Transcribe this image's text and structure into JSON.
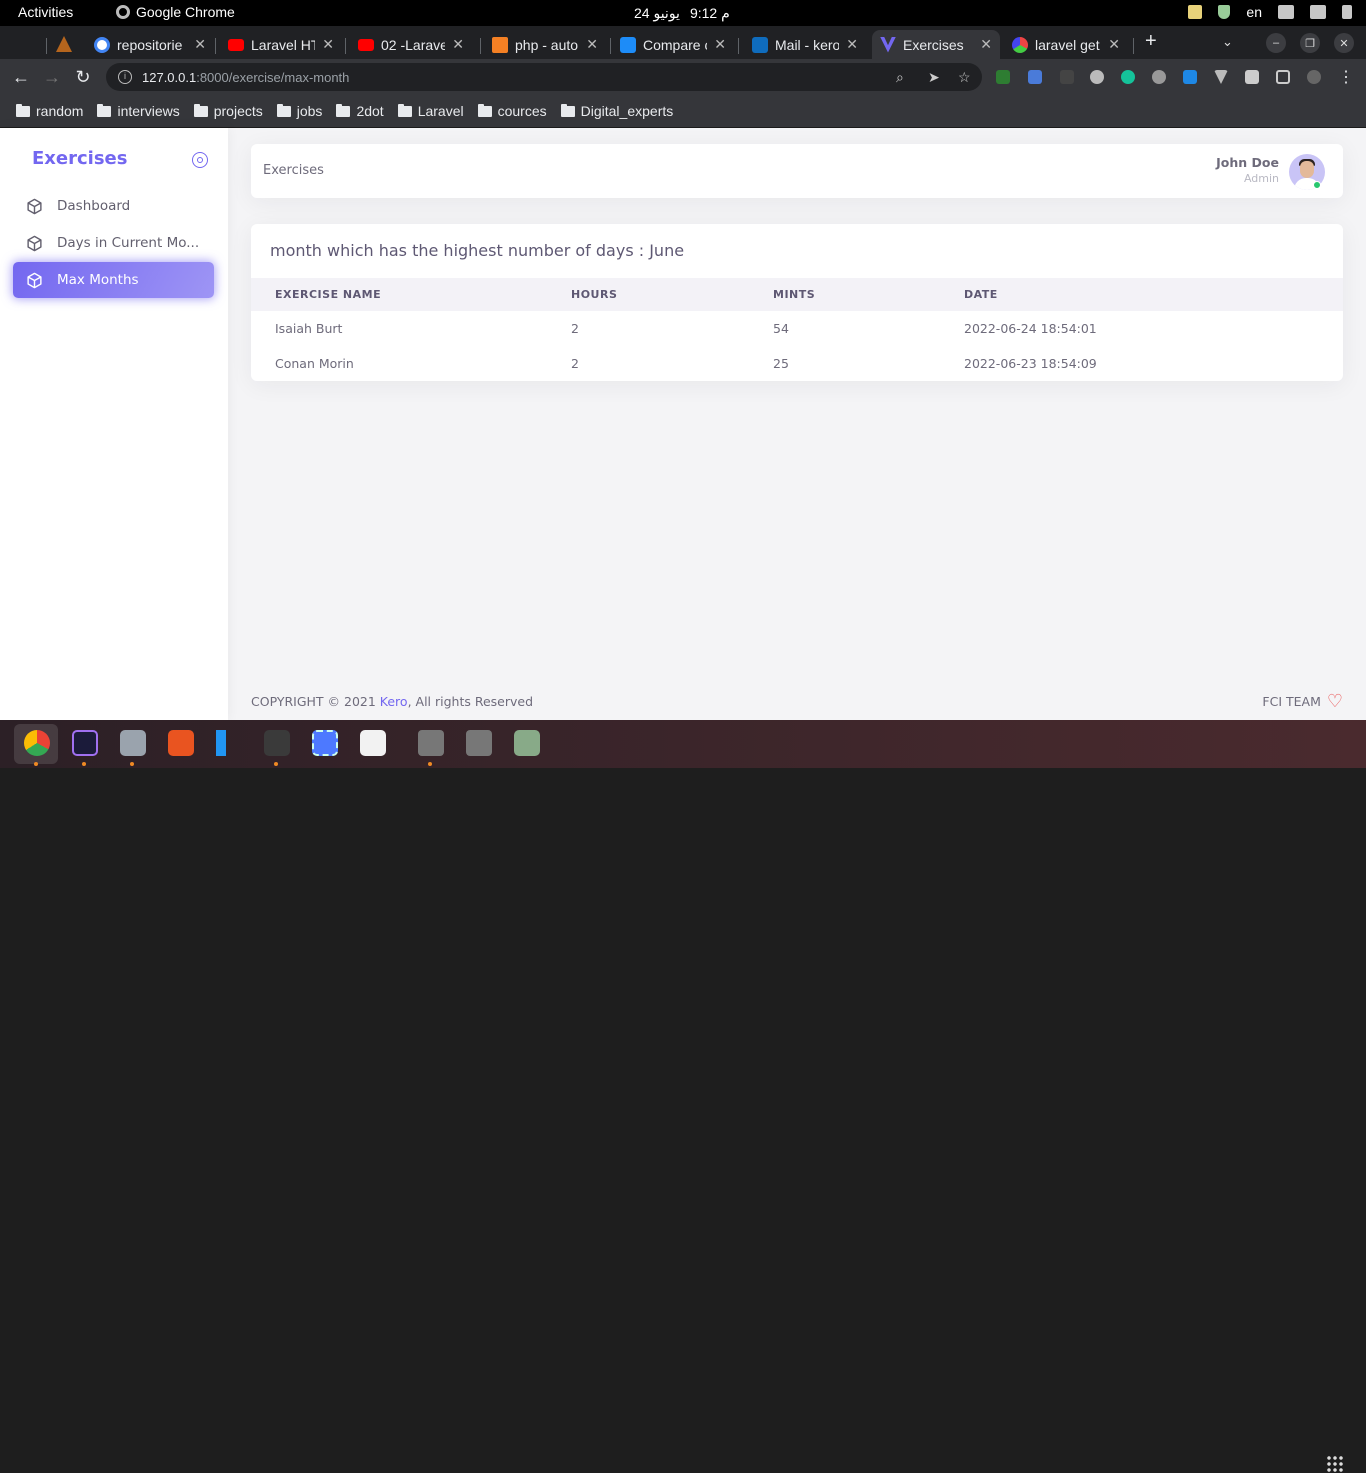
{
  "os": {
    "activities": "Activities",
    "app_name": "Google Chrome",
    "time": "9:12 م",
    "date": "24 يونيو",
    "language": "en"
  },
  "tabs": [
    {
      "title": "repositorie",
      "icon": "google-icon"
    },
    {
      "title": "Laravel HT",
      "icon": "youtube-icon"
    },
    {
      "title": "02 -Laravel",
      "icon": "youtube-icon"
    },
    {
      "title": "php - auto",
      "icon": "stackoverflow-icon"
    },
    {
      "title": "Compare c",
      "icon": "rs-icon"
    },
    {
      "title": "Mail - kero",
      "icon": "outlook-icon"
    },
    {
      "title": "Exercises",
      "icon": "vuexy-icon",
      "active": true
    },
    {
      "title": "laravel get",
      "icon": "generic-icon"
    }
  ],
  "address": {
    "host": "127.0.0.1",
    "path": ":8000/exercise/max-month"
  },
  "bookmarks": [
    "random",
    "interviews",
    "projects",
    "jobs",
    "2dot",
    "Laravel",
    "cources",
    "Digital_experts"
  ],
  "sidebar": {
    "brand": "Exercises",
    "items": [
      {
        "label": "Dashboard",
        "active": false
      },
      {
        "label": "Days in Current Mo...",
        "active": false
      },
      {
        "label": "Max Months",
        "active": true
      }
    ]
  },
  "header": {
    "breadcrumb": "Exercises",
    "user_name": "John Doe",
    "user_role": "Admin"
  },
  "card": {
    "title": "month which has the highest number of days : June",
    "columns": [
      "EXERCISE NAME",
      "HOURS",
      "MINTS",
      "DATE"
    ],
    "rows": [
      [
        "Isaiah Burt",
        "2",
        "54",
        "2022-06-24 18:54:01"
      ],
      [
        "Conan Morin",
        "2",
        "25",
        "2022-06-23 18:54:09"
      ]
    ]
  },
  "footer": {
    "copyright": "COPYRIGHT © 2021 ",
    "company": "Kero",
    "rights": ", All rights Reserved",
    "team": "FCI TEAM"
  },
  "colors": {
    "primary": "#7367f0",
    "success": "#28c76f",
    "danger": "#ea5455"
  }
}
